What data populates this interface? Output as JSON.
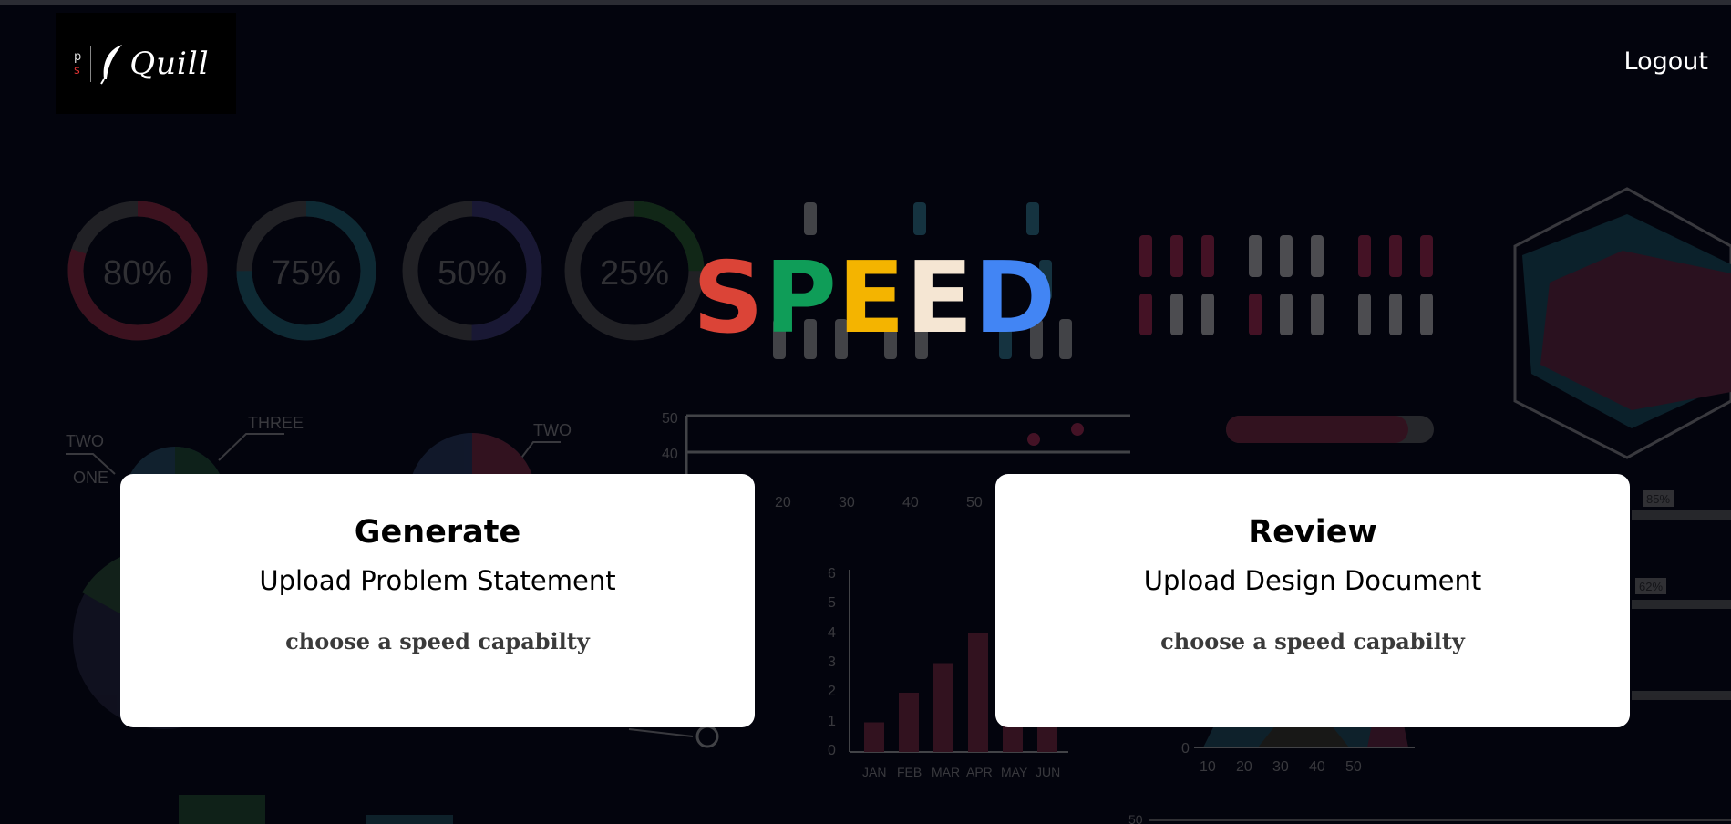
{
  "header": {
    "logo": {
      "monogram_top": "p",
      "monogram_bottom": "s",
      "brand": "Quill",
      "icon": "quill-feather-icon"
    },
    "logout_label": "Logout"
  },
  "title": {
    "letters": [
      {
        "char": "S",
        "color": "#db4437"
      },
      {
        "char": "P",
        "color": "#0f9d58"
      },
      {
        "char": "E",
        "color": "#f4b400"
      },
      {
        "char": "E",
        "color": "#f5e6d3"
      },
      {
        "char": "D",
        "color": "#4285f4"
      }
    ]
  },
  "cards": [
    {
      "title": "Generate",
      "subtitle": "Upload Problem Statement",
      "capability_prompt": "choose a speed capabilty"
    },
    {
      "title": "Review",
      "subtitle": "Upload Design Document",
      "capability_prompt": "choose a speed capabilty"
    }
  ],
  "background": {
    "donuts": [
      "80%",
      "75%",
      "50%",
      "25%"
    ],
    "callouts": [
      "TWO",
      "THREE",
      "ONE",
      "TWO"
    ],
    "line_chart_ticks_y": [
      "50",
      "40"
    ],
    "line_chart_ticks_x": [
      "20",
      "30",
      "40",
      "50"
    ],
    "bar_chart": {
      "y_ticks": [
        "6",
        "5",
        "4",
        "3",
        "2",
        "1",
        "0"
      ],
      "categories": [
        "JAN",
        "FEB",
        "MAR",
        "APR",
        "MAY",
        "JUN"
      ],
      "values": [
        1,
        2,
        3,
        4,
        1,
        1
      ]
    },
    "area_chart_x": [
      "10",
      "20",
      "30",
      "40",
      "50"
    ],
    "area_chart_y0": "0",
    "badges": [
      "85%",
      "62%"
    ],
    "axis_50": "50"
  }
}
